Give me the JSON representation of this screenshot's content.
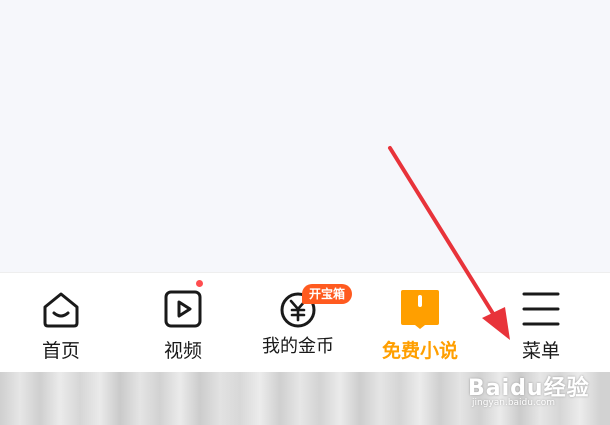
{
  "tab_bar": {
    "tabs": [
      {
        "label": "首页",
        "icon": "home-smile-icon"
      },
      {
        "label": "视频",
        "icon": "video-play-icon",
        "has_dot": true
      },
      {
        "label": "我的金币",
        "icon": "yuan-coin-icon",
        "badge": "开宝箱"
      },
      {
        "label": "免费小说",
        "icon": "book-icon",
        "active": true
      },
      {
        "label": "菜单",
        "icon": "menu-icon"
      }
    ]
  },
  "colors": {
    "active": "#ff9f00",
    "badge": "#ff5a1f",
    "dot": "#ff4d4f",
    "arrow": "#e8333a",
    "text": "#1a1a1a"
  },
  "watermark": {
    "main": "Baidu经验",
    "sub": "jingyan.baidu.com"
  }
}
